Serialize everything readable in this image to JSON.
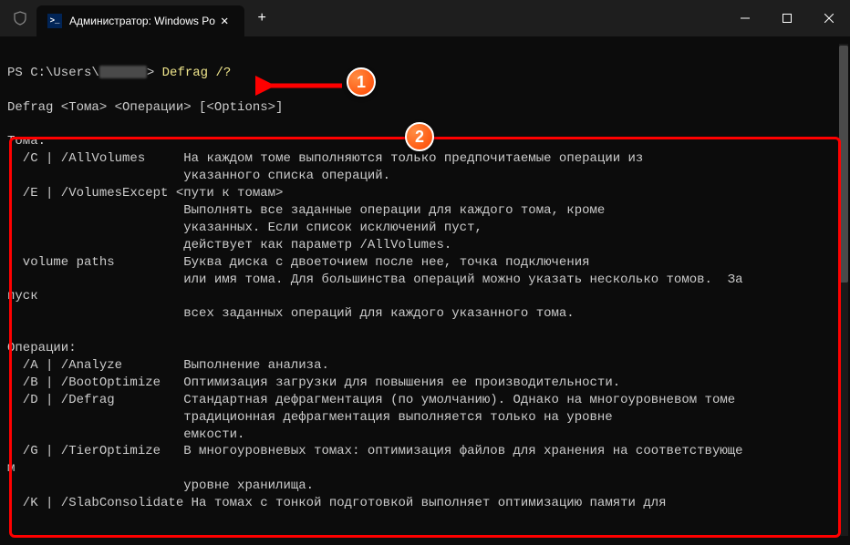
{
  "titlebar": {
    "tab_title": "Администратор: Windows Po"
  },
  "prompt": {
    "prefix": "PS C:\\Users\\",
    "suffix": "> ",
    "command": "Defrag /?"
  },
  "syntax": "Defrag <Тома> <Операции> [<Options>]",
  "toma_header": "Тома:",
  "toma": {
    "c_flag": "  /C | /AllVolumes",
    "c_desc1": "На каждом томе выполняются только предпочитаемые операции из",
    "c_desc2": "указанного списка операций.",
    "e_flag": "  /E | /VolumesExcept <пути к томам>",
    "e_desc1": "Выполнять все заданные операции для каждого тома, кроме",
    "e_desc2": "указанных. Если список исключений пуст,",
    "e_desc3": "действует как параметр /AllVolumes.",
    "vp_flag": "  volume paths",
    "vp_desc1": "Буква диска с двоеточием после нее, точка подключения",
    "vp_desc2": "или имя тома. Для большинства операций можно указать несколько томов.  За",
    "vp_wrap": "пуск",
    "vp_desc3": "всех заданных операций для каждого указанного тома."
  },
  "ops_header": "Операции:",
  "ops": {
    "a_flag": "  /A | /Analyze",
    "a_desc": "Выполнение анализа.",
    "b_flag": "  /B | /BootOptimize",
    "b_desc": "Оптимизация загрузки для повышения ее производительности.",
    "d_flag": "  /D | /Defrag",
    "d_desc1": "Стандартная дефрагментация (по умолчанию). Однако на многоуровневом томе",
    "d_desc2": "традиционная дефрагментация выполняется только на уровне",
    "d_desc3": "емкости.",
    "g_flag": "  /G | /TierOptimize",
    "g_desc1": "В многоуровневых томах: оптимизация файлов для хранения на соответствующе",
    "g_wrap": "м",
    "g_desc2": "уровне хранилища.",
    "k_flag": "  /K | /SlabConsolidate",
    "k_desc": "На томах с тонкой подготовкой выполняет оптимизацию памяти для"
  },
  "badges": {
    "one": "1",
    "two": "2"
  }
}
